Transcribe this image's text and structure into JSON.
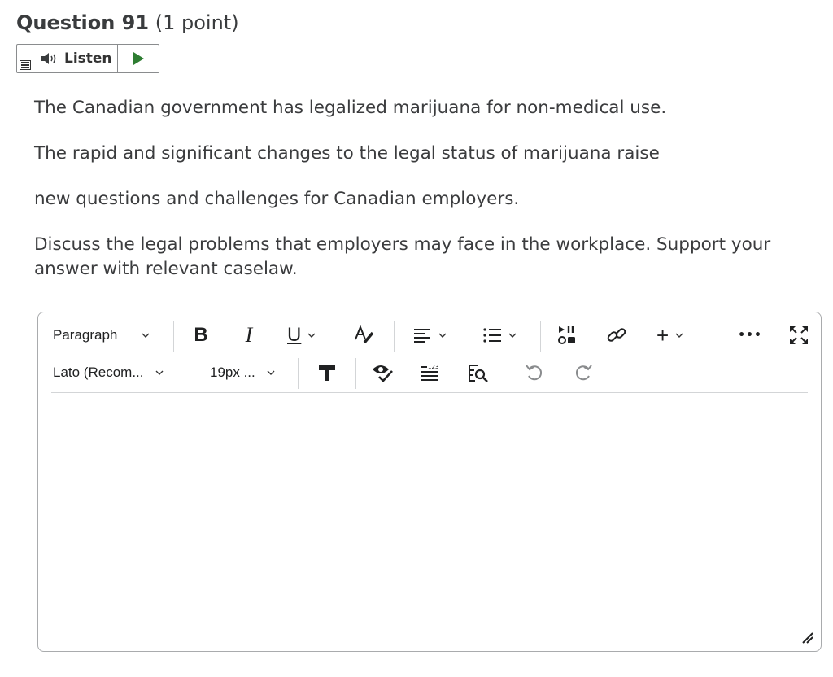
{
  "question": {
    "number": "Question 91",
    "points": "(1 point)"
  },
  "listen": {
    "label": "Listen"
  },
  "body": {
    "paragraph1": "The Canadian government has legalized marijuana for non-medical use.",
    "paragraph2": "The rapid and significant changes to the legal status of marijuana raise",
    "paragraph3": "new questions and challenges for Canadian employers.",
    "paragraph4": "Discuss the legal problems that employers may face in the workplace.  Support your answer with relevant caselaw."
  },
  "editor": {
    "block_format": "Paragraph",
    "font_family": "Lato (Recom...",
    "font_size": "19px ...",
    "bold_label": "B",
    "italic_label": "I",
    "underline_label": "U",
    "insert_label": "+",
    "more_label": "•••",
    "numbers_label": "123"
  },
  "colors": {
    "play_green": "#2e7d32",
    "border": "#a9abad",
    "text": "#3b3c3e"
  }
}
